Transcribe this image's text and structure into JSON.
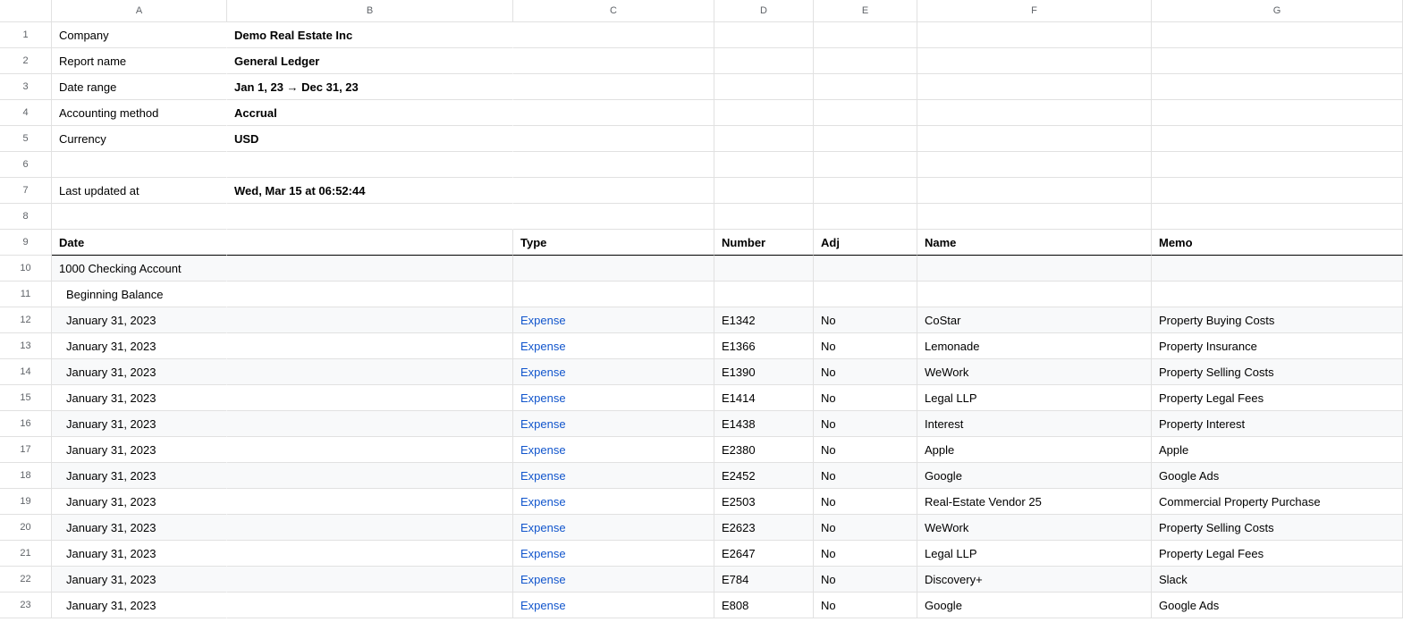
{
  "columns": [
    "A",
    "B",
    "C",
    "D",
    "E",
    "F",
    "G"
  ],
  "meta": [
    {
      "label": "Company",
      "value": "Demo Real Estate Inc"
    },
    {
      "label": "Report name",
      "value": "General Ledger"
    },
    {
      "label": "Date range",
      "value": "Jan 1, 23 → Dec 31, 23"
    },
    {
      "label": "Accounting method",
      "value": "Accrual"
    },
    {
      "label": "Currency",
      "value": "USD"
    },
    {
      "label": "",
      "value": ""
    },
    {
      "label": "Last updated at",
      "value": "Wed, Mar 15 at 06:52:44"
    },
    {
      "label": "",
      "value": ""
    }
  ],
  "headers": {
    "date": "Date",
    "type": "Type",
    "number": "Number",
    "adj": "Adj",
    "name": "Name",
    "memo": "Memo"
  },
  "account": "1000 Checking Account",
  "beginning_balance_label": "Beginning Balance",
  "entries": [
    {
      "date": "January 31, 2023",
      "type": "Expense",
      "number": "E1342",
      "adj": "No",
      "name": "CoStar",
      "memo": "Property Buying Costs"
    },
    {
      "date": "January 31, 2023",
      "type": "Expense",
      "number": "E1366",
      "adj": "No",
      "name": "Lemonade",
      "memo": "Property Insurance"
    },
    {
      "date": "January 31, 2023",
      "type": "Expense",
      "number": "E1390",
      "adj": "No",
      "name": "WeWork",
      "memo": "Property Selling Costs"
    },
    {
      "date": "January 31, 2023",
      "type": "Expense",
      "number": "E1414",
      "adj": "No",
      "name": "Legal LLP",
      "memo": "Property Legal Fees"
    },
    {
      "date": "January 31, 2023",
      "type": "Expense",
      "number": "E1438",
      "adj": "No",
      "name": "Interest",
      "memo": "Property Interest"
    },
    {
      "date": "January 31, 2023",
      "type": "Expense",
      "number": "E2380",
      "adj": "No",
      "name": "Apple",
      "memo": "Apple"
    },
    {
      "date": "January 31, 2023",
      "type": "Expense",
      "number": "E2452",
      "adj": "No",
      "name": "Google",
      "memo": "Google Ads"
    },
    {
      "date": "January 31, 2023",
      "type": "Expense",
      "number": "E2503",
      "adj": "No",
      "name": "Real-Estate Vendor 25",
      "memo": "Commercial Property Purchase"
    },
    {
      "date": "January 31, 2023",
      "type": "Expense",
      "number": "E2623",
      "adj": "No",
      "name": "WeWork",
      "memo": "Property Selling Costs"
    },
    {
      "date": "January 31, 2023",
      "type": "Expense",
      "number": "E2647",
      "adj": "No",
      "name": "Legal LLP",
      "memo": "Property Legal Fees"
    },
    {
      "date": "January 31, 2023",
      "type": "Expense",
      "number": "E784",
      "adj": "No",
      "name": "Discovery+",
      "memo": "Slack"
    },
    {
      "date": "January 31, 2023",
      "type": "Expense",
      "number": "E808",
      "adj": "No",
      "name": "Google",
      "memo": "Google Ads"
    }
  ]
}
